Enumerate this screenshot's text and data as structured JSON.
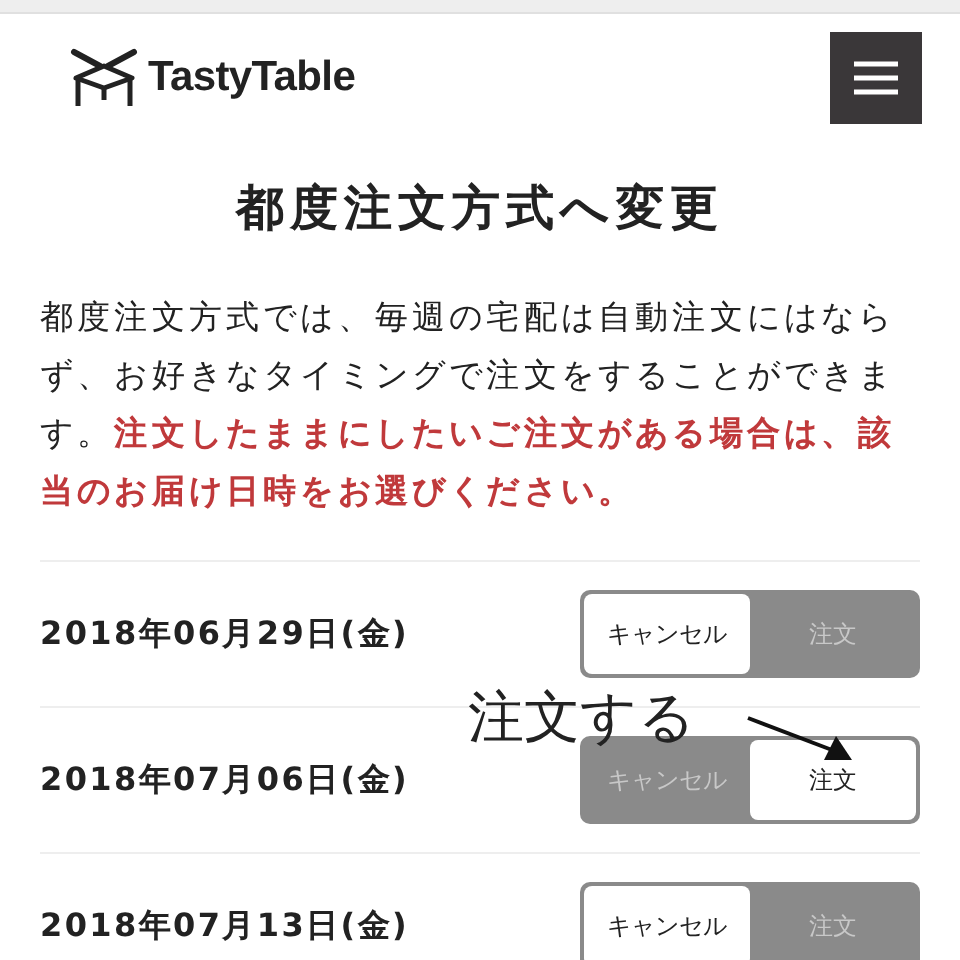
{
  "header": {
    "logo_text": "TastyTable"
  },
  "title": "都度注文方式へ変更",
  "intro": {
    "text": "都度注文方式では、毎週の宅配は自動注文にはならず、お好きなタイミングで注文をすることができます。",
    "emphasis": "注文したままにしたいご注文がある場合は、該当のお届け日時をお選びください。"
  },
  "deliveries": [
    {
      "date": "2018年06月29日(金)",
      "options": [
        {
          "label": "キャンセル",
          "selected": true
        },
        {
          "label": "注文",
          "selected": false
        }
      ]
    },
    {
      "date": "2018年07月06日(金)",
      "options": [
        {
          "label": "キャンセル",
          "selected": false
        },
        {
          "label": "注文",
          "selected": true
        }
      ]
    },
    {
      "date": "2018年07月13日(金)",
      "options": [
        {
          "label": "キャンセル",
          "selected": true
        },
        {
          "label": "注文",
          "selected": false
        }
      ]
    }
  ],
  "annotation": {
    "text": "注文する"
  }
}
